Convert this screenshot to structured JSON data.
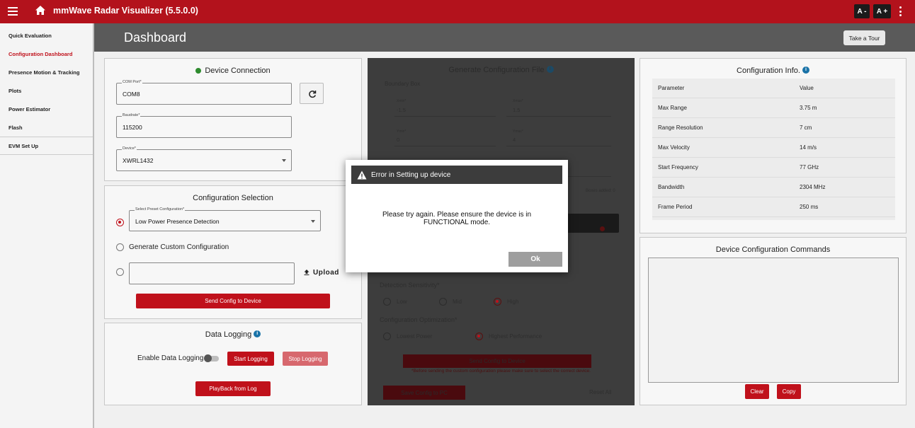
{
  "app": {
    "title": "mmWave Radar Visualizer (5.5.0.0)",
    "font_decrease": "A -",
    "font_increase": "A +"
  },
  "sidebar": {
    "items": [
      {
        "label": "Quick Evaluation"
      },
      {
        "label": "Configuration Dashboard"
      },
      {
        "label": "Presence Motion & Tracking"
      },
      {
        "label": "Plots"
      },
      {
        "label": "Power Estimator"
      },
      {
        "label": "Flash"
      },
      {
        "label": "EVM Set Up"
      }
    ]
  },
  "header": {
    "title": "Dashboard",
    "tour_button": "Take a Tour"
  },
  "device_connection": {
    "title": "Device Connection",
    "status_color": "#2e8b2e",
    "com_port_label": "COM Port*",
    "com_port_value": "COM8",
    "baudrate_label": "Baudrate*",
    "baudrate_value": "115200",
    "device_label": "Device*",
    "device_value": "XWRL1432"
  },
  "config_selection": {
    "title": "Configuration Selection",
    "preset_label": "Select Preset Configuration*",
    "preset_value": "Low Power Presence Detection",
    "custom_label": "Generate Custom Configuration",
    "upload_label": "Upload",
    "send_button": "Send Config to Device"
  },
  "data_logging": {
    "title": "Data Logging",
    "enable_label": "Enable Data Logging",
    "start_button": "Start Logging",
    "stop_button": "Stop Logging",
    "playback_button": "PlayBack from Log"
  },
  "generate": {
    "title": "Generate Configuration File",
    "boundary_box": "Boundary Box",
    "xmin_label": "Xmin*",
    "xmin_value": "-1.5",
    "xmax_label": "Xmax*",
    "xmax_value": "1.5",
    "ymin_label": "Ymin*",
    "ymin_value": "0",
    "ymax_label": "Ymax*",
    "ymax_value": "4",
    "boxes_added": "Boxes added: 0",
    "sensitivity_label": "Detection Sensitivity*",
    "sens_low": "Low",
    "sens_mid": "Mid",
    "sens_high": "High",
    "optimization_label": "Configuration Optimization*",
    "opt_low": "Lowest Power",
    "opt_high": "Highest Performance",
    "send_button": "Send Config to Device",
    "note": "*Before sending the custom configuration please make sure to select the correct device.",
    "save_button": "Save Config to PC",
    "reset_all": "Reset All"
  },
  "config_info": {
    "title": "Configuration Info.",
    "header_param": "Parameter",
    "header_value": "Value",
    "rows": [
      {
        "param": "Max Range",
        "value": "3.75 m"
      },
      {
        "param": "Range Resolution",
        "value": "7 cm"
      },
      {
        "param": "Max Velocity",
        "value": "14 m/s"
      },
      {
        "param": "Start Frequency",
        "value": "77 GHz"
      },
      {
        "param": "Bandwidth",
        "value": "2304 MHz"
      },
      {
        "param": "Frame Period",
        "value": "250 ms"
      }
    ]
  },
  "commands": {
    "title": "Device Configuration Commands",
    "clear_button": "Clear",
    "copy_button": "Copy"
  },
  "dialog": {
    "title": "Error in Setting up device",
    "message_line1": "Please try again. Please ensure the device is in",
    "message_line2": "FUNCTIONAL mode.",
    "ok_button": "Ok"
  },
  "colors": {
    "brand_red": "#b3121c",
    "dark": "#3d3d3d"
  },
  "icons": [
    "menu-icon",
    "home-icon",
    "refresh-icon",
    "upload-icon",
    "info-icon",
    "warning-icon",
    "dropdown-arrow-icon",
    "more-vertical-icon"
  ]
}
